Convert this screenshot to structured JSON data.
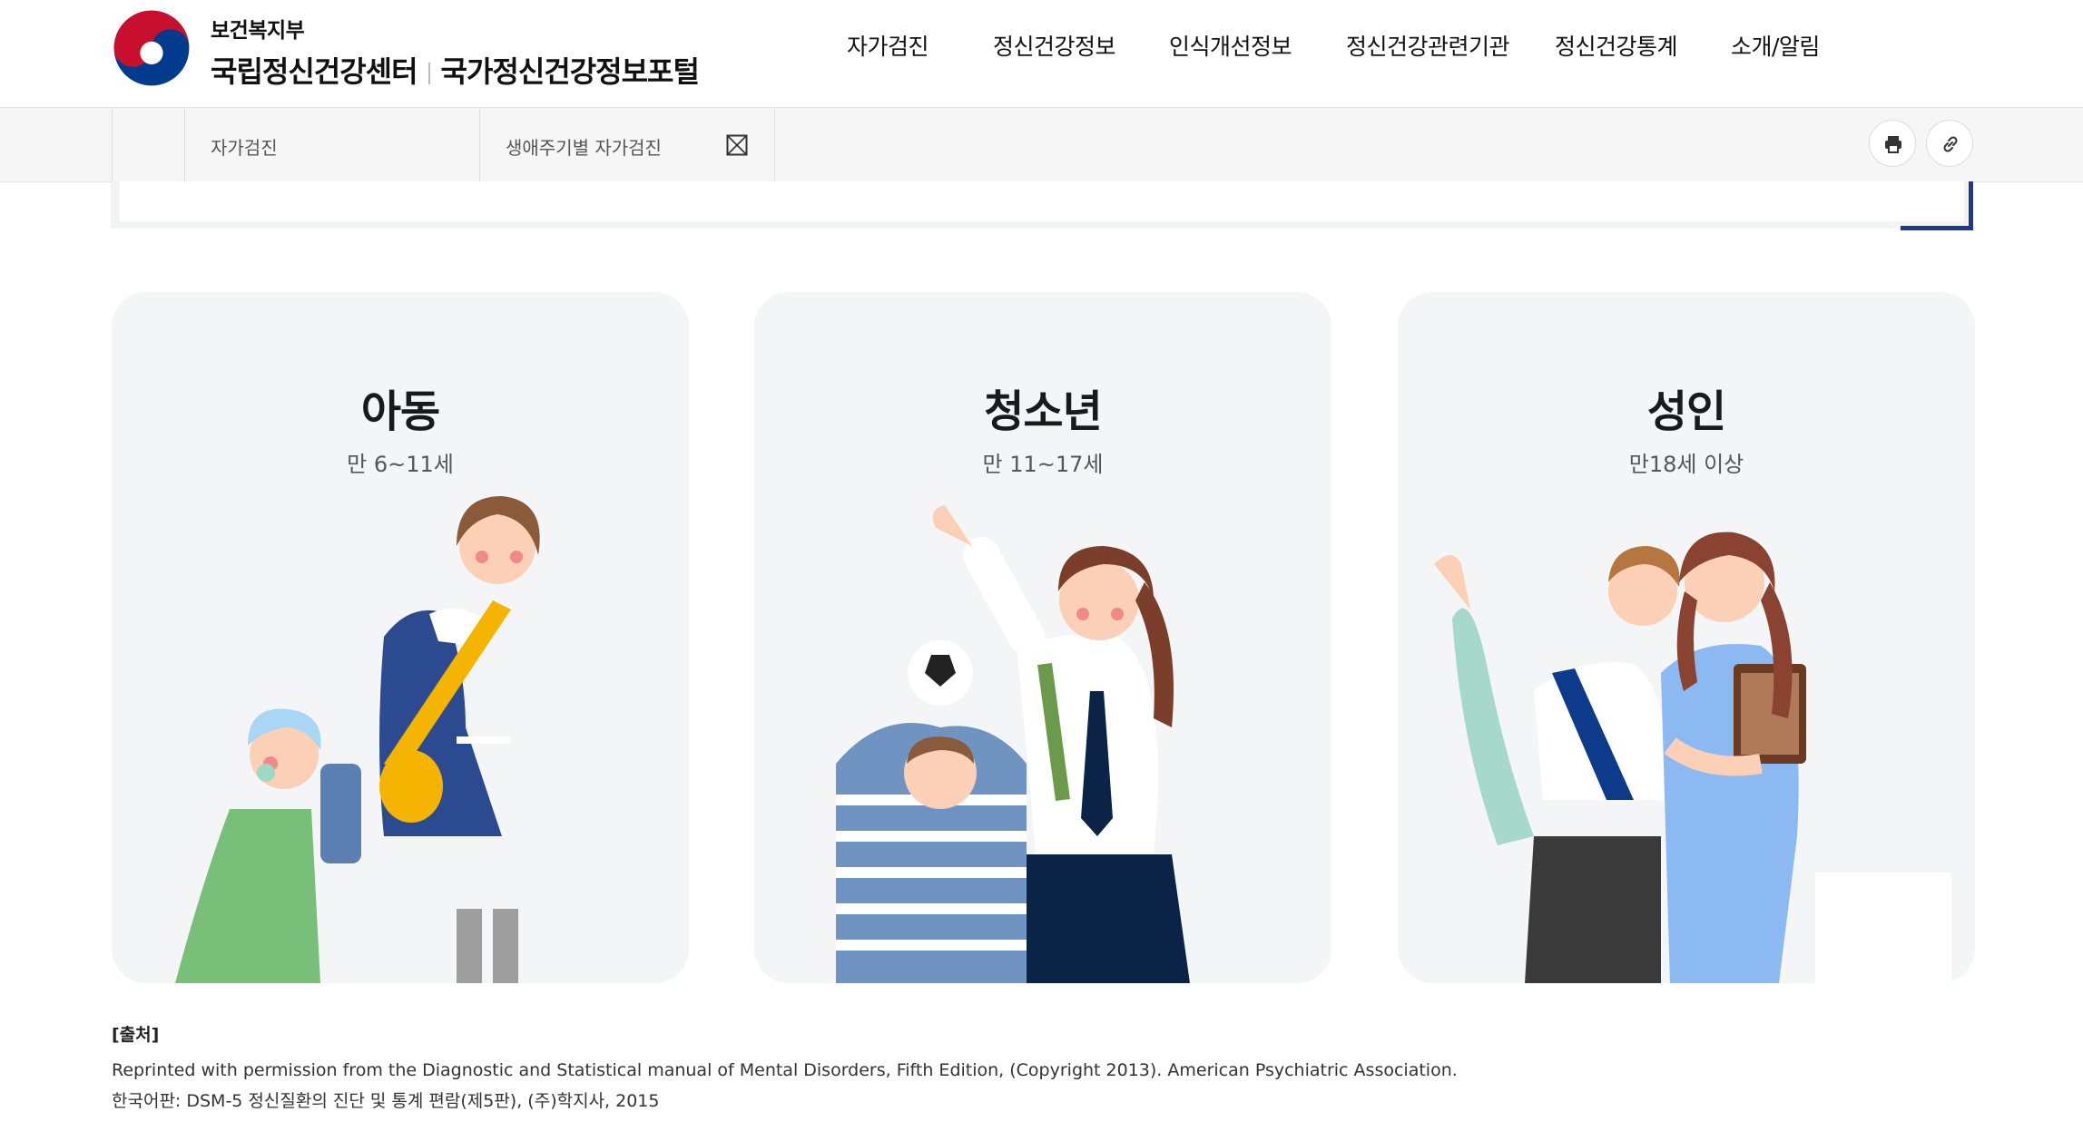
{
  "header": {
    "ministry": "보건복지부",
    "center_name": "국립정신건강센터",
    "portal_name": "국가정신건강정보포털",
    "nav": [
      {
        "label": "자가검진"
      },
      {
        "label": "정신건강정보"
      },
      {
        "label": "인식개선정보"
      },
      {
        "label": "정신건강관련기관"
      },
      {
        "label": "정신건강통계"
      },
      {
        "label": "소개/알림"
      }
    ]
  },
  "breadcrumb": {
    "level1": "자가검진",
    "level2": "생애주기별 자가검진"
  },
  "tools": {
    "print_icon": "print-icon",
    "link_icon": "link-icon"
  },
  "cards": [
    {
      "title": "아동",
      "age": "만 6~11세"
    },
    {
      "title": "청소년",
      "age": "만 11~17세"
    },
    {
      "title": "성인",
      "age": "만18세 이상"
    }
  ],
  "source": {
    "title": "[출처]",
    "line1": "Reprinted with permission from the Diagnostic and Statistical manual of Mental Disorders, Fifth Edition, (Copyright 2013). American Psychiatric Association.",
    "line2": "한국어판: DSM-5 정신질환의 진단 및 통계 편람(제5판), (주)학지사, 2015"
  },
  "colors": {
    "accent_navy": "#1e3b8a",
    "card_bg": "#f3f5f7",
    "logo_red": "#c8102e",
    "logo_blue": "#003b8e"
  }
}
